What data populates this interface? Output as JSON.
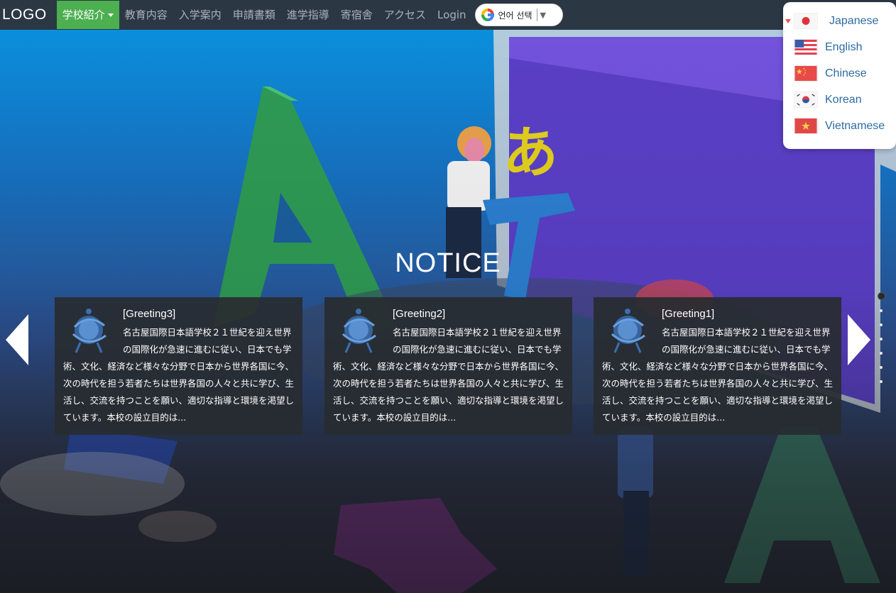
{
  "navbar": {
    "logo": "LOGO",
    "items": [
      {
        "label": "学校紹介",
        "active": true,
        "has_dropdown": true
      },
      {
        "label": "教育内容"
      },
      {
        "label": "入学案内"
      },
      {
        "label": "申請書類"
      },
      {
        "label": "進学指導"
      },
      {
        "label": "寄宿舎"
      },
      {
        "label": "アクセス"
      },
      {
        "label": "Login"
      }
    ],
    "translate": {
      "label": "언어 선택",
      "arrow": "▼",
      "icon": "google-g-icon"
    }
  },
  "hero": {
    "title": "NOTICE",
    "cards": [
      {
        "title": "[Greeting3]",
        "body": "名古屋国際日本語学校２１世紀を迎え世界の国際化が急速に進むに従い、日本でも学術、文化、経済など様々な分野で日本から世界各国に今、次の時代を担う若者たちは世界各国の人々と共に学び、生活し、交流を持つことを願い、適切な指導と環境を渇望しています。本校の設立目的は..."
      },
      {
        "title": "[Greeting2]",
        "body": "名古屋国際日本語学校２１世紀を迎え世界の国際化が急速に進むに従い、日本でも学術、文化、経済など様々な分野で日本から世界各国に今、次の時代を担う若者たちは世界各国の人々と共に学び、生活し、交流を持つことを願い、適切な指導と環境を渇望しています。本校の設立目的は..."
      },
      {
        "title": "[Greeting1]",
        "body": "名古屋国際日本語学校２１世紀を迎え世界の国際化が急速に進むに従い、日本でも学術、文化、経済など様々な分野で日本から世界各国に今、次の時代を担う若者たちは世界各国の人々と共に学び、生活し、交流を持つことを願い、適切な指導と環境を渇望しています。本校の設立目的は..."
      }
    ],
    "carousel": {
      "prev_icon": "chevron-left-icon",
      "next_icon": "chevron-right-icon"
    },
    "dots": {
      "count": 7,
      "active_index": 0
    }
  },
  "language_menu": {
    "items": [
      {
        "label": "Japanese",
        "flag": "japan-flag-icon",
        "selected": true
      },
      {
        "label": "English",
        "flag": "us-flag-icon"
      },
      {
        "label": "Chinese",
        "flag": "china-flag-icon"
      },
      {
        "label": "Korean",
        "flag": "korea-flag-icon"
      },
      {
        "label": "Vietnamese",
        "flag": "vietnam-flag-icon"
      }
    ]
  },
  "colors": {
    "navbar_bg": "#2c3744",
    "active_nav": "#4caf50",
    "nav_text": "#a9b2bb",
    "card_bg": "#282c30",
    "lang_text": "#2e6ba0"
  }
}
